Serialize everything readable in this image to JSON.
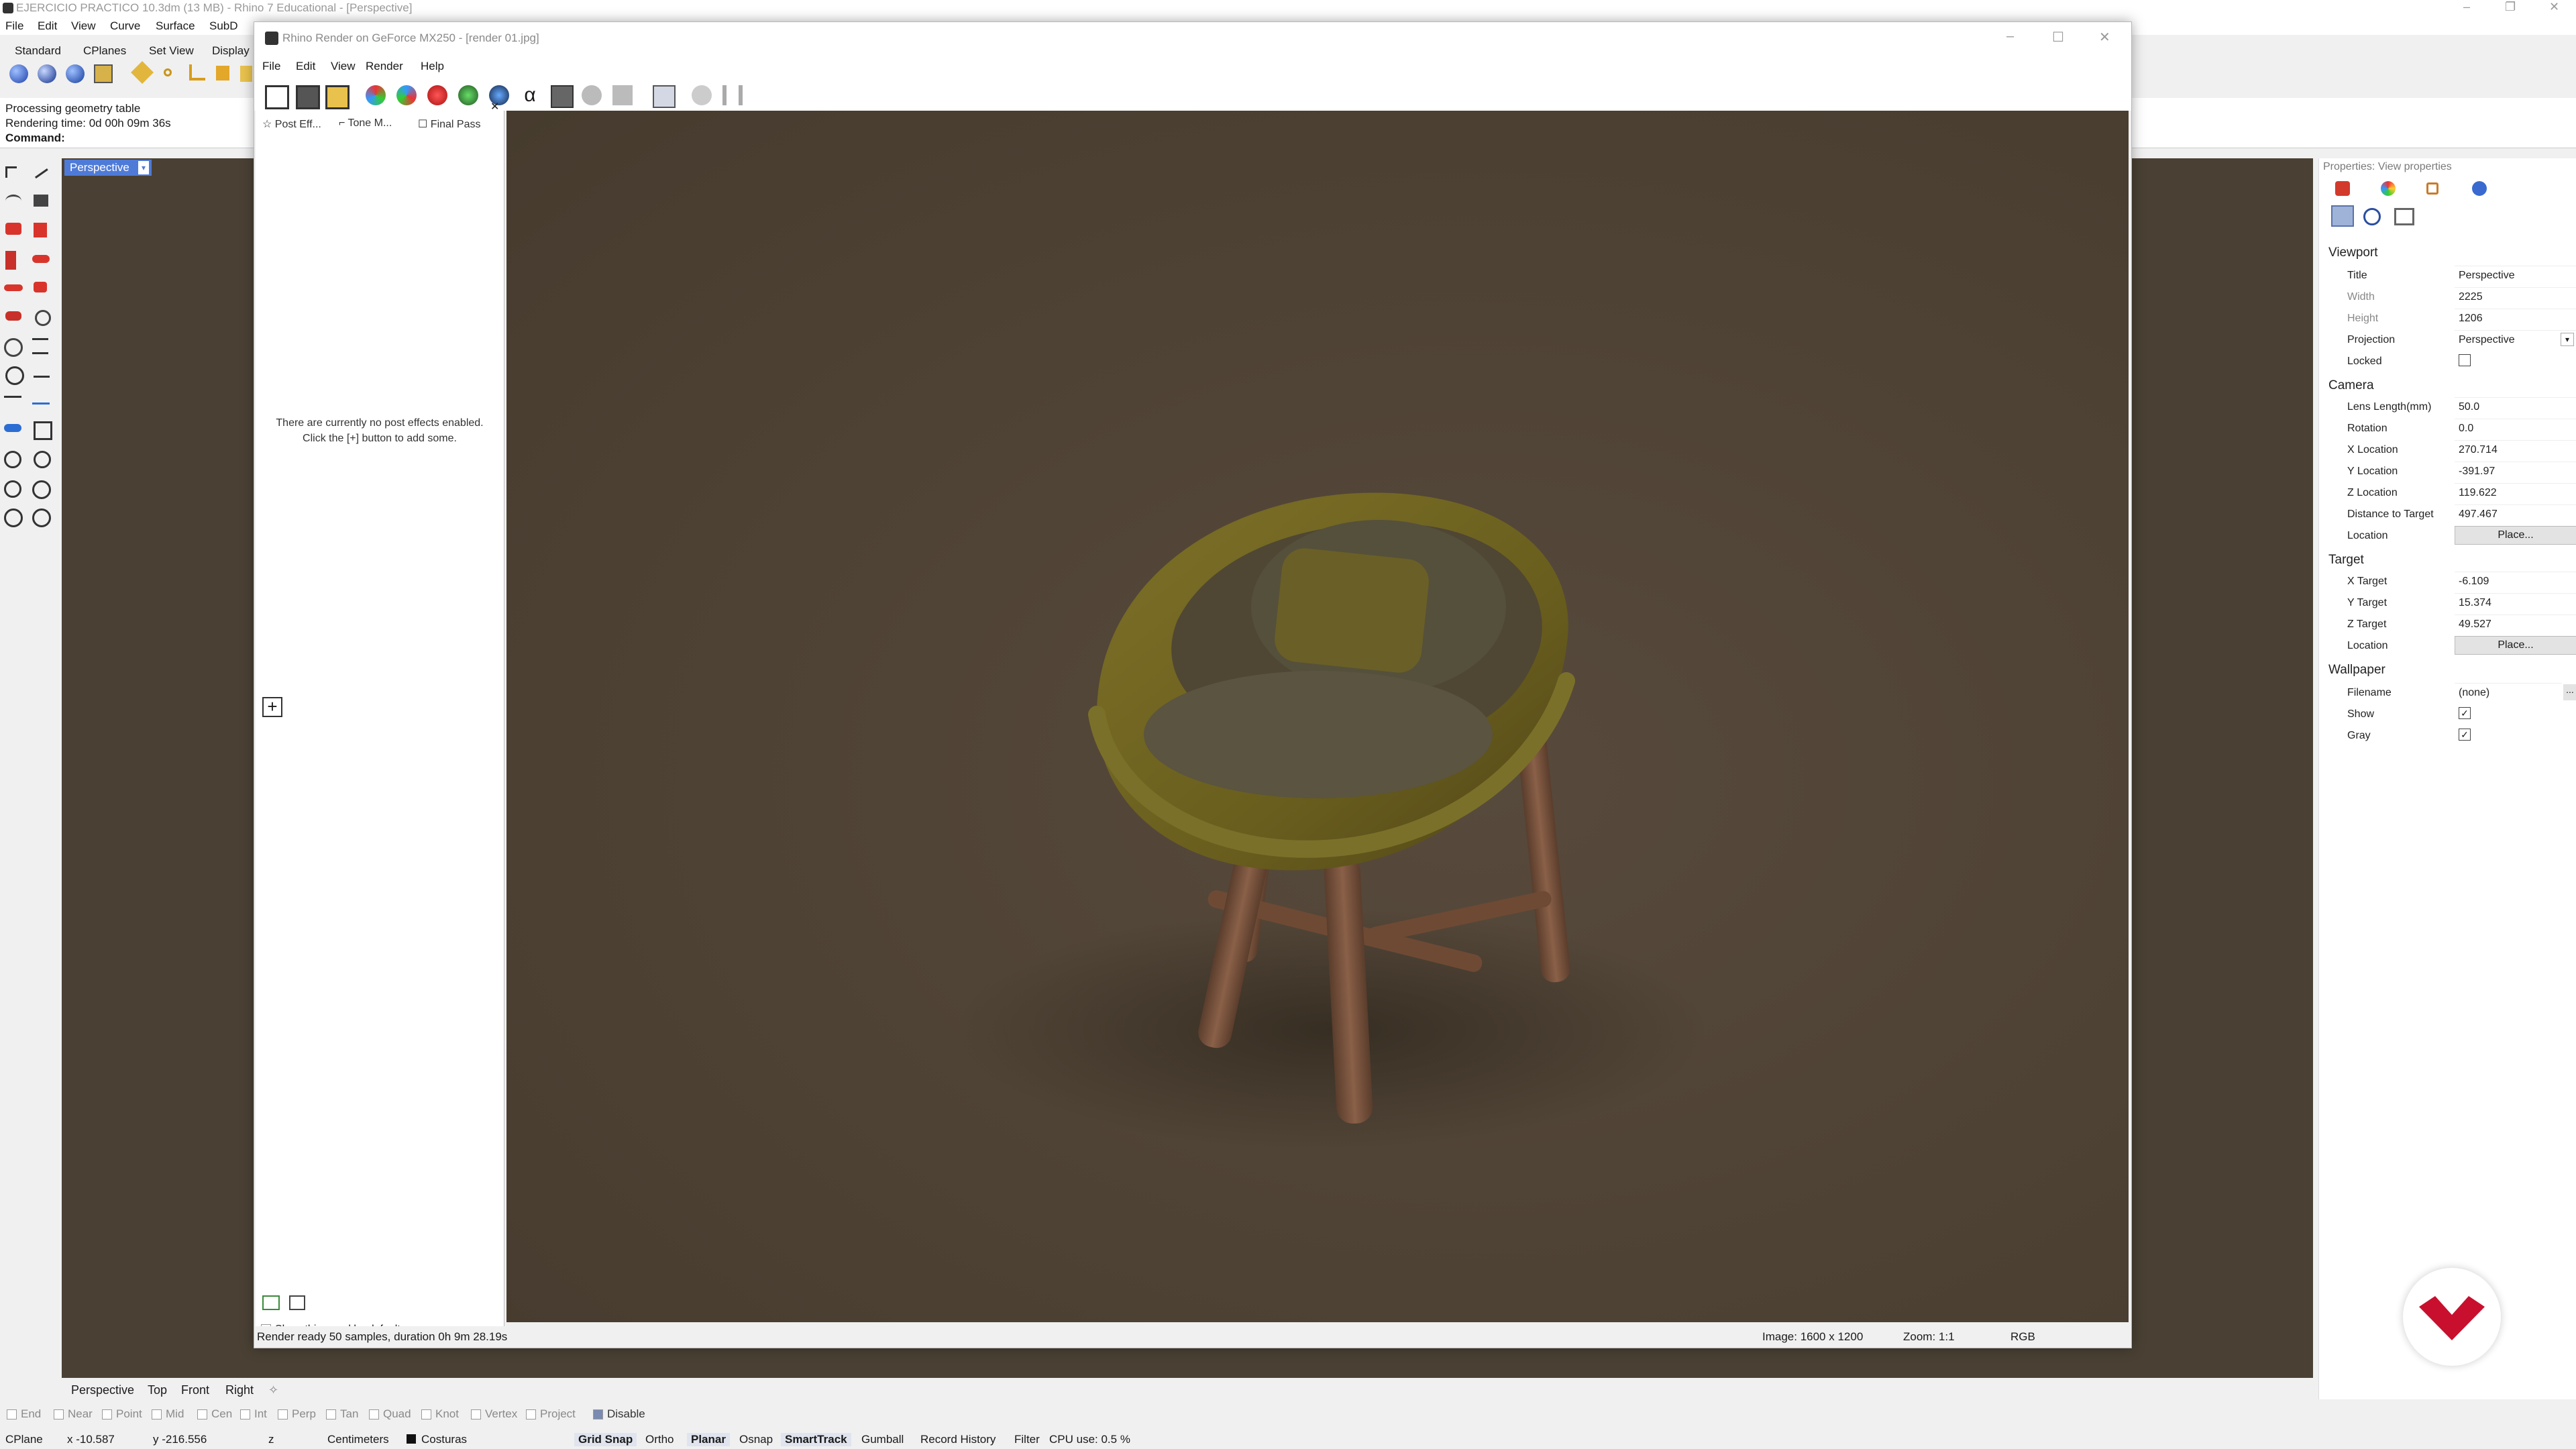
{
  "main_window": {
    "title": "EJERCICIO PRACTICO 10.3dm (13 MB) - Rhino 7 Educational - [Perspective]",
    "menu": [
      "File",
      "Edit",
      "View",
      "Curve",
      "Surface",
      "SubD"
    ],
    "toolbar_tabs": [
      "Standard",
      "CPlanes",
      "Set View",
      "Display"
    ]
  },
  "command_area": {
    "history_line1": "Processing geometry table",
    "history_line2": "Rendering time: 0d 00h 09m 36s",
    "prompt": "Command:"
  },
  "viewport": {
    "label": "Perspective",
    "tabs": [
      "Perspective",
      "Top",
      "Front",
      "Right"
    ]
  },
  "render_window": {
    "title": "Rhino Render on GeForce MX250 - [render 01.jpg]",
    "menu": [
      "File",
      "Edit",
      "View",
      "Render",
      "Help"
    ],
    "side_tabs": [
      "Post Eff...",
      "Tone M...",
      "Final Pass"
    ],
    "no_effects_line1": "There are currently no post effects enabled.",
    "no_effects_line2": "Click the [+] button to add some.",
    "add_button": "+",
    "show_panel_label": "Show this panel by default",
    "status_left": "Render ready 50 samples, duration 0h 9m 28.19s",
    "status_image": "Image: 1600 x 1200",
    "status_zoom": "Zoom: 1:1",
    "status_mode": "RGB"
  },
  "properties": {
    "header": "Properties: View properties",
    "sections": {
      "viewport": "Viewport",
      "camera": "Camera",
      "target": "Target",
      "wallpaper": "Wallpaper"
    },
    "labels": {
      "title": "Title",
      "width": "Width",
      "height": "Height",
      "projection": "Projection",
      "locked": "Locked",
      "lens": "Lens Length(mm)",
      "rotation": "Rotation",
      "xloc": "X Location",
      "yloc": "Y Location",
      "zloc": "Z Location",
      "dist": "Distance to Target",
      "location": "Location",
      "xt": "X Target",
      "yt": "Y Target",
      "zt": "Z Target",
      "filename": "Filename",
      "show": "Show",
      "gray": "Gray"
    },
    "values": {
      "title": "Perspective",
      "width": "2225",
      "height": "1206",
      "projection": "Perspective",
      "lens": "50.0",
      "rotation": "0.0",
      "xloc": "270.714",
      "yloc": "-391.97",
      "zloc": "119.622",
      "dist": "497.467",
      "place": "Place...",
      "xt": "-6.109",
      "yt": "15.374",
      "zt": "49.527",
      "filename": "(none)",
      "browse": "..."
    },
    "checks": {
      "locked": false,
      "show": true,
      "gray": true
    }
  },
  "osnap": {
    "items": [
      "End",
      "Near",
      "Point",
      "Mid",
      "Cen",
      "Int",
      "Perp",
      "Tan",
      "Quad",
      "Knot",
      "Vertex",
      "Project",
      "Disable"
    ]
  },
  "statusbar": {
    "cplane": "CPlane",
    "x": "x -10.587",
    "y": "y -216.556",
    "z": "z",
    "units": "Centimeters",
    "layer": "Costuras",
    "toggles": [
      "Grid Snap",
      "Ortho",
      "Planar",
      "Osnap",
      "SmartTrack",
      "Gumball",
      "Record History",
      "Filter"
    ],
    "cpu": "CPU use: 0.5 %"
  },
  "colors": {
    "viewport_bg": "#4a4134",
    "render_bg": "#4e4234",
    "chair_fabric": "#6e6224",
    "chair_wood": "#6e4a34",
    "viewport_label": "#4f7bd8",
    "brand_red": "#c8102e"
  }
}
